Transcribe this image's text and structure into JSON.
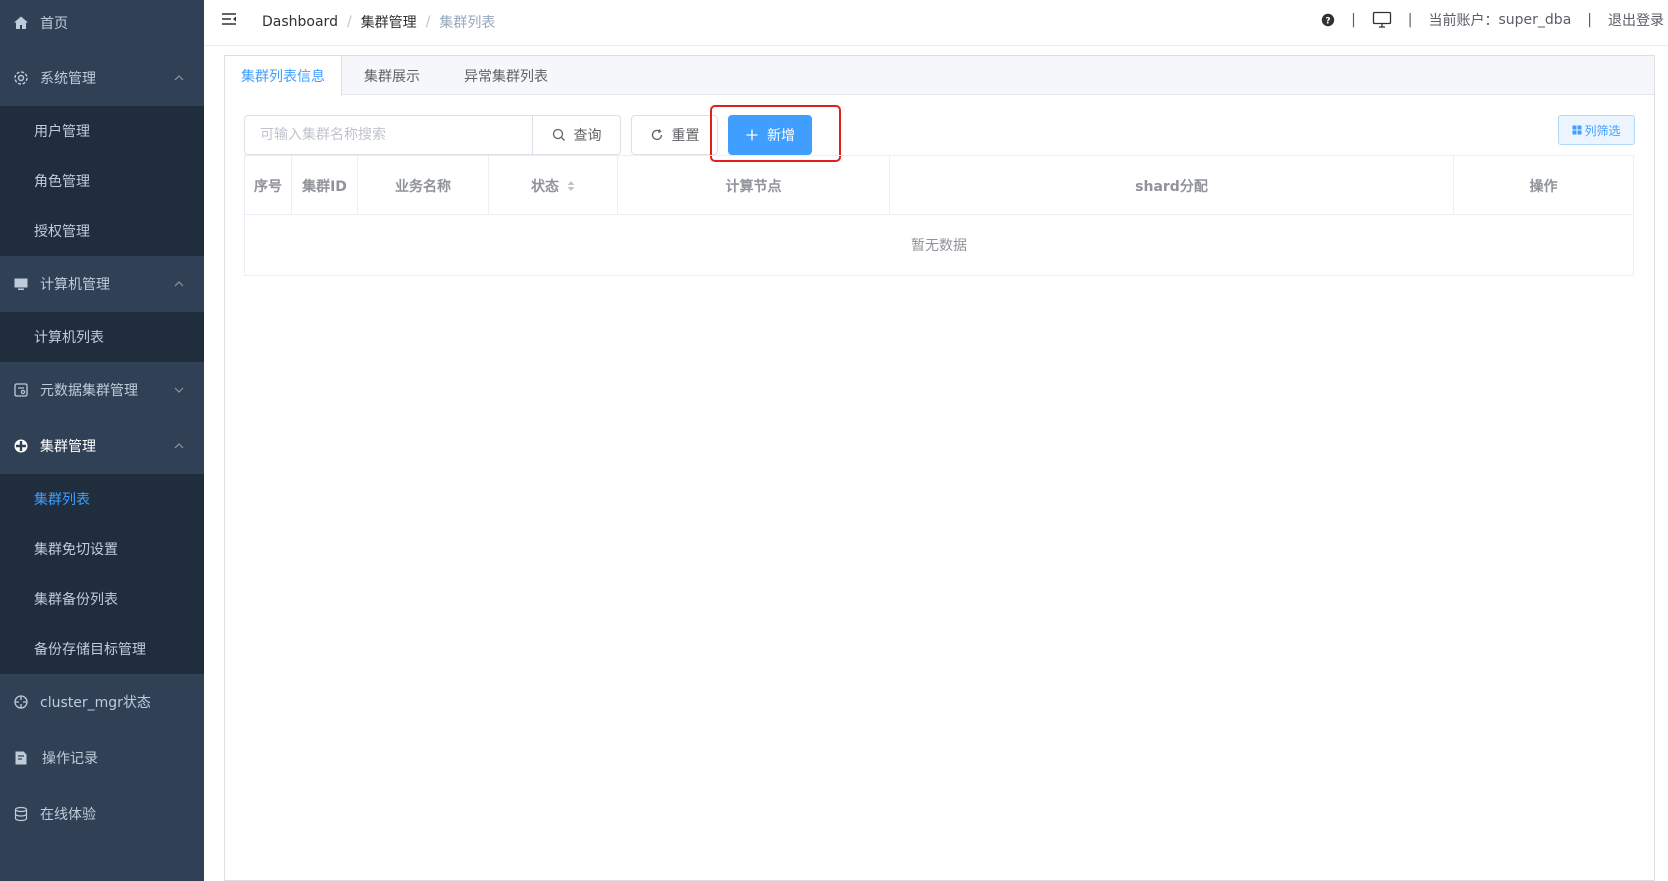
{
  "sidebar": {
    "home": {
      "label": "首页",
      "icon": "home-icon"
    },
    "system": {
      "label": "系统管理",
      "icon": "gear-icon",
      "children": [
        "用户管理",
        "角色管理",
        "授权管理"
      ]
    },
    "computer": {
      "label": "计算机管理",
      "icon": "monitor-icon",
      "children": [
        "计算机列表"
      ]
    },
    "metadata": {
      "label": "元数据集群管理",
      "icon": "database-panel-icon"
    },
    "cluster": {
      "label": "集群管理",
      "icon": "cluster-icon",
      "children": [
        "集群列表",
        "集群免切设置",
        "集群备份列表",
        "备份存储目标管理"
      ]
    },
    "cluster_mgr": {
      "label": "cluster_mgr状态",
      "icon": "crosshair-icon"
    },
    "oplog": {
      "label": "操作记录",
      "icon": "document-edit-icon"
    },
    "online": {
      "label": "在线体验",
      "icon": "database-icon"
    }
  },
  "header": {
    "breadcrumb": [
      "Dashboard",
      "集群管理",
      "集群列表"
    ],
    "current_account_label": "当前账户：",
    "account": "super_dba",
    "logout": "退出登录"
  },
  "tabs": [
    "集群列表信息",
    "集群展示",
    "异常集群列表"
  ],
  "toolbar": {
    "search_placeholder": "可输入集群名称搜索",
    "query_label": "查询",
    "reset_label": "重置",
    "add_label": "新增",
    "column_filter_label": "列筛选"
  },
  "table": {
    "columns": [
      "序号",
      "集群ID",
      "业务名称",
      "状态",
      "计算节点",
      "shard分配",
      "操作"
    ],
    "empty_text": "暂无数据"
  },
  "colors": {
    "sidebar_bg": "#304156",
    "submenu_bg": "#1f2d3d",
    "accent": "#409eff",
    "highlight": "#e02020"
  }
}
